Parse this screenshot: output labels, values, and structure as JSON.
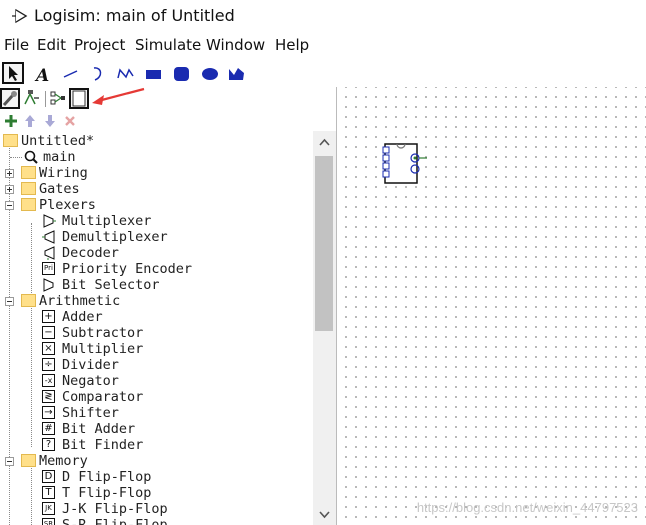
{
  "window": {
    "title": "Logisim: main of Untitled"
  },
  "menu": [
    "File",
    "Edit",
    "Project",
    "Simulate",
    "Window",
    "Help"
  ],
  "toolbar": {
    "tools": [
      "poke-tool",
      "text-tool",
      "line-tool",
      "curve-tool",
      "polyline-tool",
      "rectangle-tool",
      "rounded-rectangle-tool",
      "oval-tool",
      "polygon-tool"
    ],
    "row2": [
      "edit-layout",
      "edit-appearance"
    ],
    "selected_tool": "poke-tool"
  },
  "project_toolbar": [
    "add-circuit",
    "move-up",
    "move-down",
    "delete-circuit"
  ],
  "tree": {
    "root": "Untitled*",
    "main": "main",
    "wiring": "Wiring",
    "gates": "Gates",
    "plexers": "Plexers",
    "plexer_items": [
      "Multiplexer",
      "Demultiplexer",
      "Decoder",
      "Priority Encoder",
      "Bit Selector"
    ],
    "arithmetic": "Arithmetic",
    "arith_items": [
      "Adder",
      "Subtractor",
      "Multiplier",
      "Divider",
      "Negator",
      "Comparator",
      "Shifter",
      "Bit Adder",
      "Bit Finder"
    ],
    "arith_glyphs": [
      "+",
      "−",
      "×",
      "÷",
      "-x",
      "≷",
      "→",
      "#",
      "?"
    ],
    "memory": "Memory",
    "memory_items": [
      "D Flip-Flop",
      "T Flip-Flop",
      "J-K Flip-Flop",
      "S-R Flip-Flop"
    ],
    "memory_glyphs": [
      "D",
      "T",
      "JK",
      "SR"
    ]
  },
  "watermark": "https://blog.csdn.net/weixin_44797523"
}
